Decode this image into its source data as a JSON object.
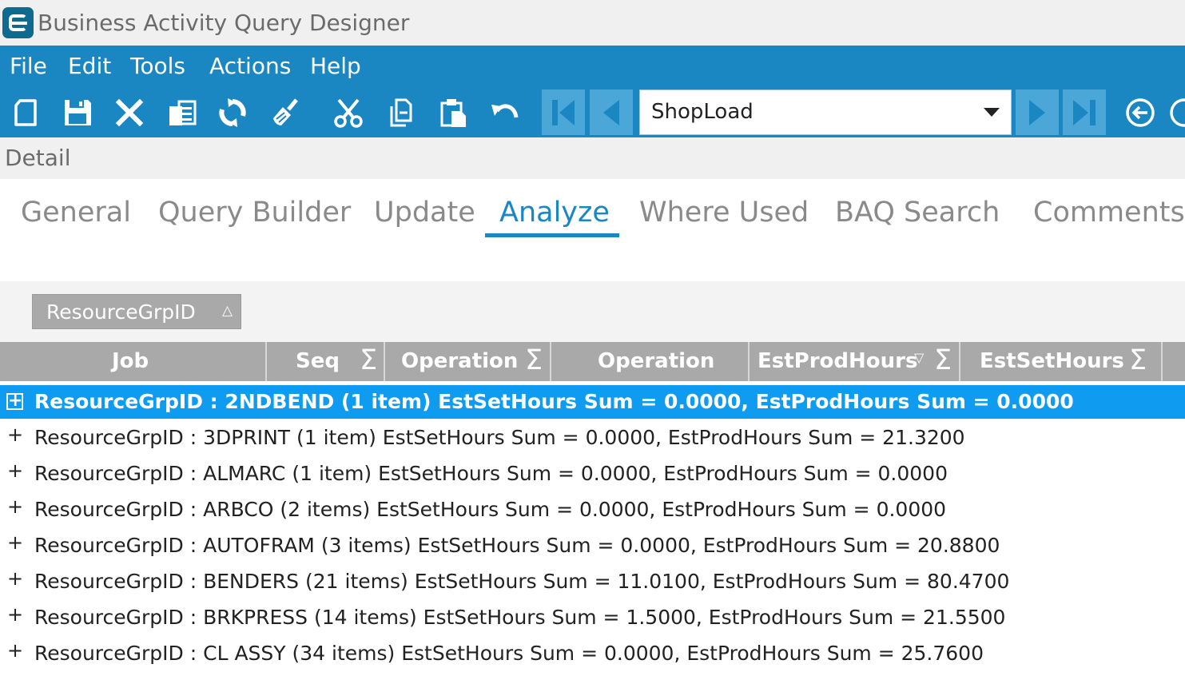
{
  "window": {
    "title": "Business Activity Query Designer"
  },
  "menu": {
    "items": [
      "File",
      "Edit",
      "Tools",
      "Actions",
      "Help"
    ]
  },
  "toolbar": {
    "icons": [
      "new-icon",
      "save-icon",
      "delete-icon",
      "copy-icon",
      "refresh-icon",
      "clear-icon",
      "cut-icon",
      "copy-clipboard-icon",
      "paste-icon",
      "undo-icon",
      "first-record-icon",
      "previous-record-icon",
      "next-record-icon",
      "last-record-icon",
      "back-icon"
    ],
    "query_value": "ShopLoad"
  },
  "section": {
    "title": "Detail"
  },
  "tabs": [
    {
      "label": "General",
      "active": false
    },
    {
      "label": "Query Builder",
      "active": false
    },
    {
      "label": "Update",
      "active": false
    },
    {
      "label": "Analyze",
      "active": true
    },
    {
      "label": "Where Used",
      "active": false
    },
    {
      "label": "BAQ Search",
      "active": false
    },
    {
      "label": "Comments",
      "active": false
    }
  ],
  "group_by": {
    "label": "ResourceGrpID",
    "sort_icon": "△"
  },
  "grid": {
    "columns": [
      {
        "label": "Job",
        "sigma": false,
        "filter": false
      },
      {
        "label": "Seq",
        "sigma": true,
        "filter": false
      },
      {
        "label": "Operation",
        "sigma": true,
        "filter": false
      },
      {
        "label": "Operation",
        "sigma": false,
        "filter": false
      },
      {
        "label": "EstProdHours",
        "sigma": true,
        "filter": true
      },
      {
        "label": "EstSetHours",
        "sigma": true,
        "filter": false
      }
    ],
    "sigma_symbol": "Σ",
    "filter_symbol": "▽",
    "groups": [
      {
        "expander": "+",
        "text": "ResourceGrpID : 2NDBEND (1 item) EstSetHours Sum = 0.0000, EstProdHours Sum = 0.0000",
        "selected": true
      },
      {
        "expander": "+",
        "text": "ResourceGrpID : 3DPRINT (1 item) EstSetHours Sum = 0.0000, EstProdHours Sum = 21.3200",
        "selected": false
      },
      {
        "expander": "+",
        "text": "ResourceGrpID : ALMARC (1 item) EstSetHours Sum = 0.0000, EstProdHours Sum = 0.0000",
        "selected": false
      },
      {
        "expander": "+",
        "text": "ResourceGrpID : ARBCO (2 items) EstSetHours Sum = 0.0000, EstProdHours Sum = 0.0000",
        "selected": false
      },
      {
        "expander": "+",
        "text": "ResourceGrpID : AUTOFRAM (3 items) EstSetHours Sum = 0.0000, EstProdHours Sum = 20.8800",
        "selected": false
      },
      {
        "expander": "+",
        "text": "ResourceGrpID : BENDERS (21 items) EstSetHours Sum = 11.0100, EstProdHours Sum = 80.4700",
        "selected": false
      },
      {
        "expander": "+",
        "text": "ResourceGrpID : BRKPRESS (14 items) EstSetHours Sum = 1.5000, EstProdHours Sum = 21.5500",
        "selected": false
      },
      {
        "expander": "+",
        "text": "ResourceGrpID : CL ASSY (34 items) EstSetHours Sum = 0.0000, EstProdHours Sum = 25.7600",
        "selected": false
      }
    ]
  },
  "colors": {
    "accent": "#1a87c2",
    "selected_row": "#0f9bef",
    "header_gray": "#a9a9a9"
  }
}
